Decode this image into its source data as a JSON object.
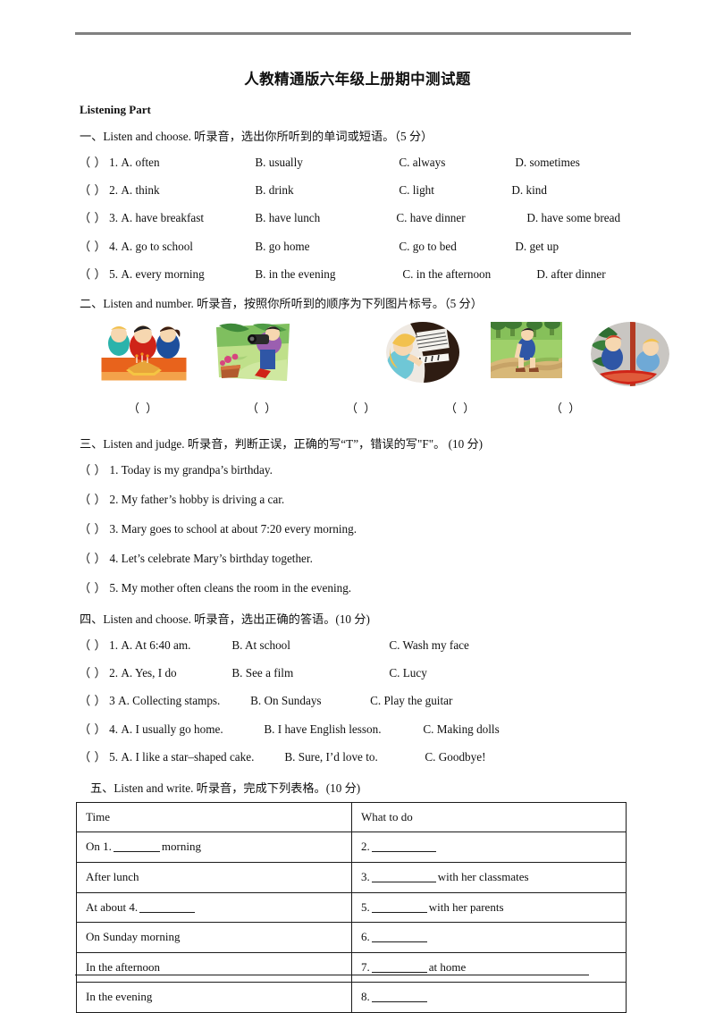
{
  "document": {
    "title": "人教精通版六年级上册期中测试题",
    "part_heading": "Listening Part"
  },
  "sections": [
    {
      "heading": "一、Listen and choose. 听录音，选出你所听到的单词或短语。（5 分）",
      "questions": [
        {
          "paren": "（  ）",
          "num": "1.",
          "a": "A. often",
          "b": "B. usually",
          "c": "C. always",
          "d": "D. sometimes"
        },
        {
          "paren": "（  ）",
          "num": "2.",
          "a": "A. think",
          "b": "B. drink",
          "c": "C. light",
          "d": "D. kind"
        },
        {
          "paren": "（  ）",
          "num": "3.",
          "a": "A. have breakfast",
          "b": "B. have lunch",
          "c": "C. have dinner",
          "d": "D. have some bread"
        },
        {
          "paren": "（  ）",
          "num": "4.",
          "a": "A. go to school",
          "b": "B. go home",
          "c": "C. go to bed",
          "d": "D. get up"
        },
        {
          "paren": "（  ）",
          "num": "5.",
          "a": "A. every morning",
          "b": "B. in the evening",
          "c": "C. in the afternoon",
          "d": "D. after dinner"
        }
      ]
    },
    {
      "heading": "二、Listen and number. 听录音，按照你所听到的顺序为下列图片标号。（5 分）",
      "pictures": [
        {
          "alt": "children-around-star-birthday-cake",
          "shape": "rect"
        },
        {
          "alt": "person-taking-photo-in-garden",
          "shape": "rect"
        },
        {
          "alt": "girl-playing-piano",
          "shape": "oval"
        },
        {
          "alt": "boy-walking-in-park",
          "shape": "rect"
        },
        {
          "alt": "children-indoors-at-christmas-tree",
          "shape": "oval"
        }
      ],
      "answer_slots": [
        "（  ）",
        "（  ）",
        "（  ）",
        "（  ）",
        "（  ）"
      ]
    },
    {
      "heading": "三、Listen and judge. 听录音，判断正误，正确的写“T”，错误的写\"F\"。 (10 分)",
      "statements": [
        {
          "paren": "（  ）",
          "text": "1. Today is my grandpa’s birthday."
        },
        {
          "paren": "（  ）",
          "text": "2. My father’s hobby is driving a car."
        },
        {
          "paren": "（  ）",
          "text": "3. Mary goes to school at about 7:20 every morning."
        },
        {
          "paren": "（  ）",
          "text": "4. Let’s celebrate Mary’s birthday together."
        },
        {
          "paren": "（  ）",
          "text": "5. My mother often cleans the room in the evening."
        }
      ]
    },
    {
      "heading": "四、Listen and choose. 听录音，选出正确的答语。(10 分)",
      "questions": [
        {
          "paren": "（  ）",
          "num": "1.",
          "a": "A. At 6:40 am.",
          "b": "B. At school",
          "c": "C. Wash my face"
        },
        {
          "paren": "（  ）",
          "num": "2.",
          "a": "A. Yes, I do",
          "b": "B. See a film",
          "c": "C. Lucy"
        },
        {
          "paren": "（  ）",
          "num": "3",
          "a": "A. Collecting stamps.",
          "b": "B. On Sundays",
          "c": "C. Play the guitar"
        },
        {
          "paren": "（  ）",
          "num": "4.",
          "a": "A. I usually go home.",
          "b": "B. I have English lesson.",
          "c": "C. Making dolls"
        },
        {
          "paren": "（  ）",
          "num": "5.",
          "a": "A. I like a star–shaped cake.",
          "b": "B. Sure, I’d love to.",
          "c": "C. Goodbye!"
        }
      ]
    },
    {
      "heading": "五、Listen and write. 听录音，完成下列表格。(10 分)",
      "table": {
        "headers": [
          "Time",
          "What to do"
        ],
        "rows": [
          {
            "time_prefix": "On 1.",
            "time_suffix": "morning",
            "what_prefix": "2.",
            "what_suffix": ""
          },
          {
            "time_prefix": "After lunch",
            "time_suffix": "",
            "what_prefix": "3.",
            "what_suffix": "with her classmates"
          },
          {
            "time_prefix": "At about 4.",
            "time_suffix": "",
            "what_prefix": "5.",
            "what_suffix": "with her parents"
          },
          {
            "time_prefix": "On Sunday morning",
            "time_suffix": "",
            "what_prefix": "6.",
            "what_suffix": ""
          },
          {
            "time_prefix": "In the afternoon",
            "time_suffix": "",
            "what_prefix": "7.",
            "what_suffix": "at home"
          },
          {
            "time_prefix": "In the evening",
            "time_suffix": "",
            "what_prefix": "8.",
            "what_suffix": ""
          }
        ]
      }
    }
  ],
  "colors": {
    "rule_top": "#808080",
    "rule_bottom": "#1a1a1a",
    "table_border": "#1b1b1b",
    "text": "#101010"
  }
}
